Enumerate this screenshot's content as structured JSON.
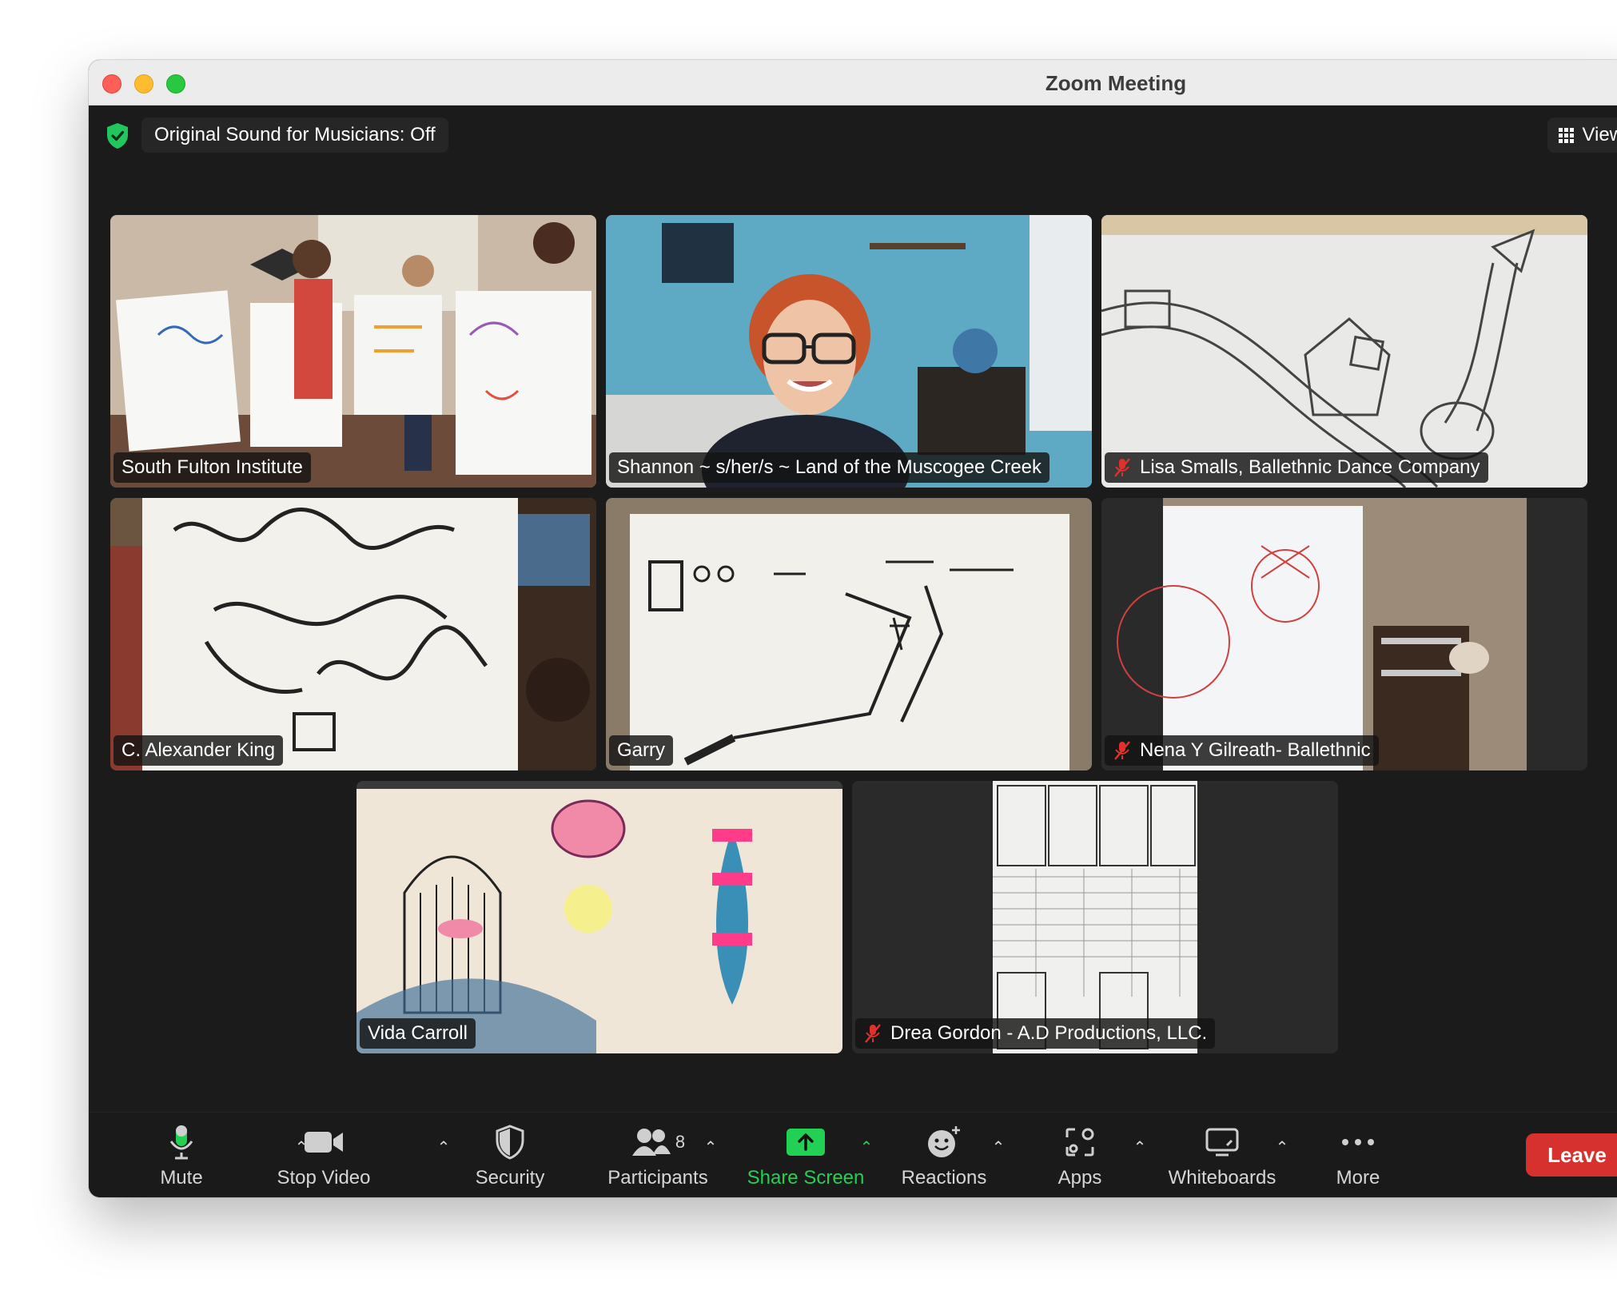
{
  "window": {
    "title": "Zoom Meeting"
  },
  "topbar": {
    "sound_label": "Original Sound for Musicians: Off",
    "view_label": "View"
  },
  "participants": [
    {
      "name": "South Fulton Institute",
      "muted": false,
      "active": false
    },
    {
      "name": "Shannon ~ s/her/s ~ Land of the Muscogee Creek",
      "muted": false,
      "active": true
    },
    {
      "name": "Lisa Smalls, Ballethnic Dance Company",
      "muted": true,
      "active": false
    },
    {
      "name": "C. Alexander King",
      "muted": false,
      "active": false
    },
    {
      "name": "Garry",
      "muted": false,
      "active": false
    },
    {
      "name": "Nena Y Gilreath- Ballethnic",
      "muted": true,
      "active": false
    },
    {
      "name": "Vida Carroll",
      "muted": false,
      "active": false
    },
    {
      "name": "Drea Gordon - A.D Productions, LLC.",
      "muted": true,
      "active": false
    }
  ],
  "toolbar": {
    "mute": "Mute",
    "stop_video": "Stop Video",
    "security": "Security",
    "participants": "Participants",
    "participants_count": "8",
    "share_screen": "Share Screen",
    "reactions": "Reactions",
    "apps": "Apps",
    "whiteboards": "Whiteboards",
    "more": "More",
    "leave": "Leave"
  },
  "colors": {
    "accent_green": "#22d154",
    "leave_red": "#d6312e",
    "muted_red": "#e0312b"
  }
}
